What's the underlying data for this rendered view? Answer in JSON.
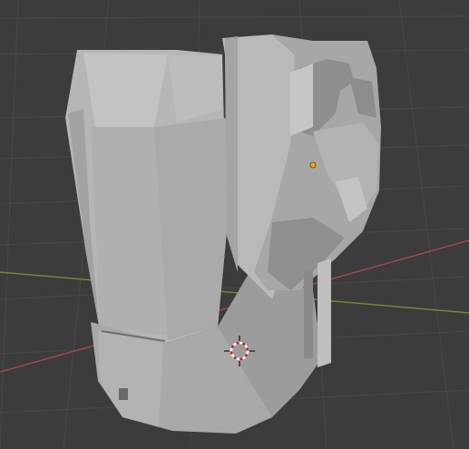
{
  "viewport": {
    "background_color": "#3c3c3c",
    "grid_color": "#474747",
    "x_axis_color": "#a04850",
    "y_axis_color": "#6f8a38"
  },
  "scene": {
    "object_name_hidden": "",
    "object_color": "#b4b4b4",
    "origin_point_color": "#ff9f1a",
    "cursor_icon": "3d-cursor-icon"
  }
}
